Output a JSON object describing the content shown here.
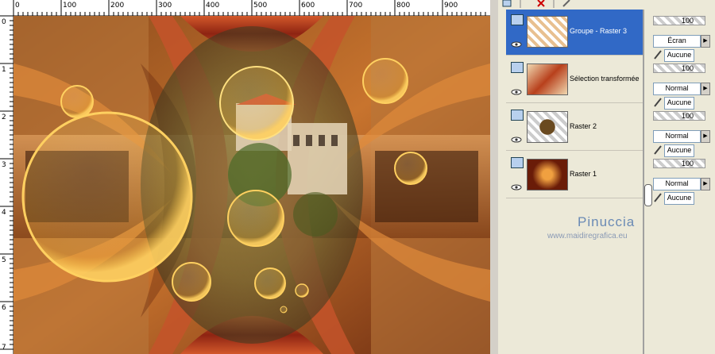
{
  "ruler": {
    "top_ticks": [
      "0",
      "100",
      "200",
      "300",
      "400",
      "500",
      "600",
      "700",
      "800",
      "900"
    ],
    "left_ticks": [
      "0",
      "1",
      "2",
      "3",
      "4",
      "5",
      "6",
      "7"
    ]
  },
  "layers": [
    {
      "name": "Groupe - Raster 3",
      "selected": true,
      "opacity": "100",
      "blend": "Écran",
      "mask": "Aucune"
    },
    {
      "name": "Sélection transformée",
      "selected": false,
      "opacity": "100",
      "blend": "Normal",
      "mask": "Aucune"
    },
    {
      "name": "Raster 2",
      "selected": false,
      "opacity": "100",
      "blend": "Normal",
      "mask": "Aucune"
    },
    {
      "name": "Raster 1",
      "selected": false,
      "opacity": "100",
      "blend": "Normal",
      "mask": "Aucune"
    }
  ],
  "watermark": {
    "name": "Pinuccia",
    "url": "www.maidiregrafica.eu"
  },
  "colors": {
    "selected": "#3169c6",
    "panel": "#ece9d8",
    "accent": "#c4532a"
  }
}
